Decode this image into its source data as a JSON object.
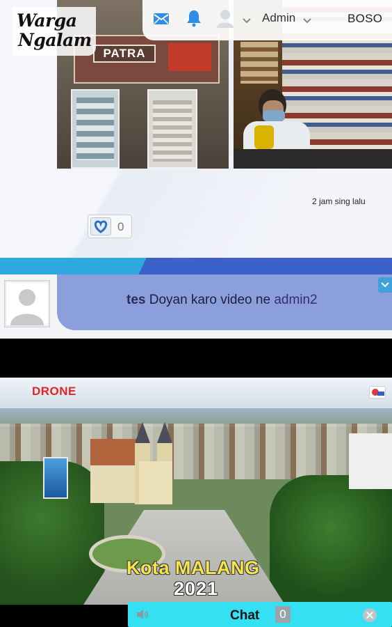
{
  "header": {
    "logo_line1": "Warga",
    "logo_line2": "Ngalam",
    "user_label": "Admin",
    "language_label": "BOSO",
    "mail_icon": "mail-icon",
    "bell_icon": "bell-icon",
    "user_icon": "user-icon"
  },
  "post": {
    "shop_sign": "PATRA",
    "time_ago": "2 jam sing lalu",
    "like_count": "0",
    "like_icon": "heart-icon"
  },
  "notification": {
    "user": "tes",
    "message": " Doyan karo video ne ",
    "target": "admin2"
  },
  "video": {
    "tag": "DRONE",
    "title": "Kota MALANG",
    "year": "2021"
  },
  "chat": {
    "label": "Chat",
    "count": "0",
    "speaker_icon": "speaker-icon",
    "close_icon": "close-icon"
  },
  "colors": {
    "band_light": "#2fa8e0",
    "band_dark": "#3c61c9",
    "bubble": "#8a9fdc",
    "chat_bar": "#35e0f2",
    "drone_tag": "#e32424",
    "video_title": "#f5e44a"
  }
}
